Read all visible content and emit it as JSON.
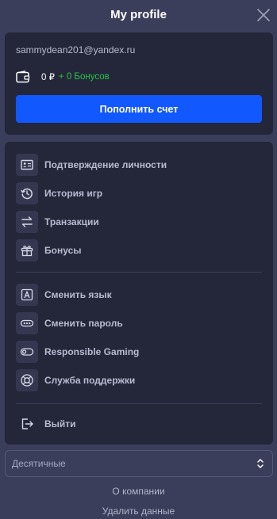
{
  "header": {
    "title": "My profile",
    "close_icon": "close-icon"
  },
  "account": {
    "email": "sammydean201@yandex.ru",
    "balance": "0 ₽",
    "bonus": "+ 0 Бонусов",
    "topup_label": "Пополнить счет"
  },
  "menu": {
    "items": [
      {
        "label": "Подтверждение личности",
        "icon": "id-card-icon"
      },
      {
        "label": "История игр",
        "icon": "history-icon"
      },
      {
        "label": "Транзакции",
        "icon": "transfer-arrows-icon"
      },
      {
        "label": "Бонусы",
        "icon": "gift-icon"
      }
    ],
    "settings": [
      {
        "label": "Сменить язык",
        "icon": "letter-a-icon"
      },
      {
        "label": "Сменить пароль",
        "icon": "password-icon"
      },
      {
        "label": "Responsible Gaming",
        "icon": "toggle-icon"
      },
      {
        "label": "Служба поддержки",
        "icon": "lifebuoy-icon"
      }
    ],
    "logout_label": "Выйти"
  },
  "odds_format": {
    "selected": "Десятичные"
  },
  "footer": {
    "about_label": "О компании",
    "delete_label": "Удалить данные"
  },
  "colors": {
    "background": "#3b3e5a",
    "card": "#24263a",
    "accent": "#1158ff",
    "bonus": "#29c447"
  }
}
